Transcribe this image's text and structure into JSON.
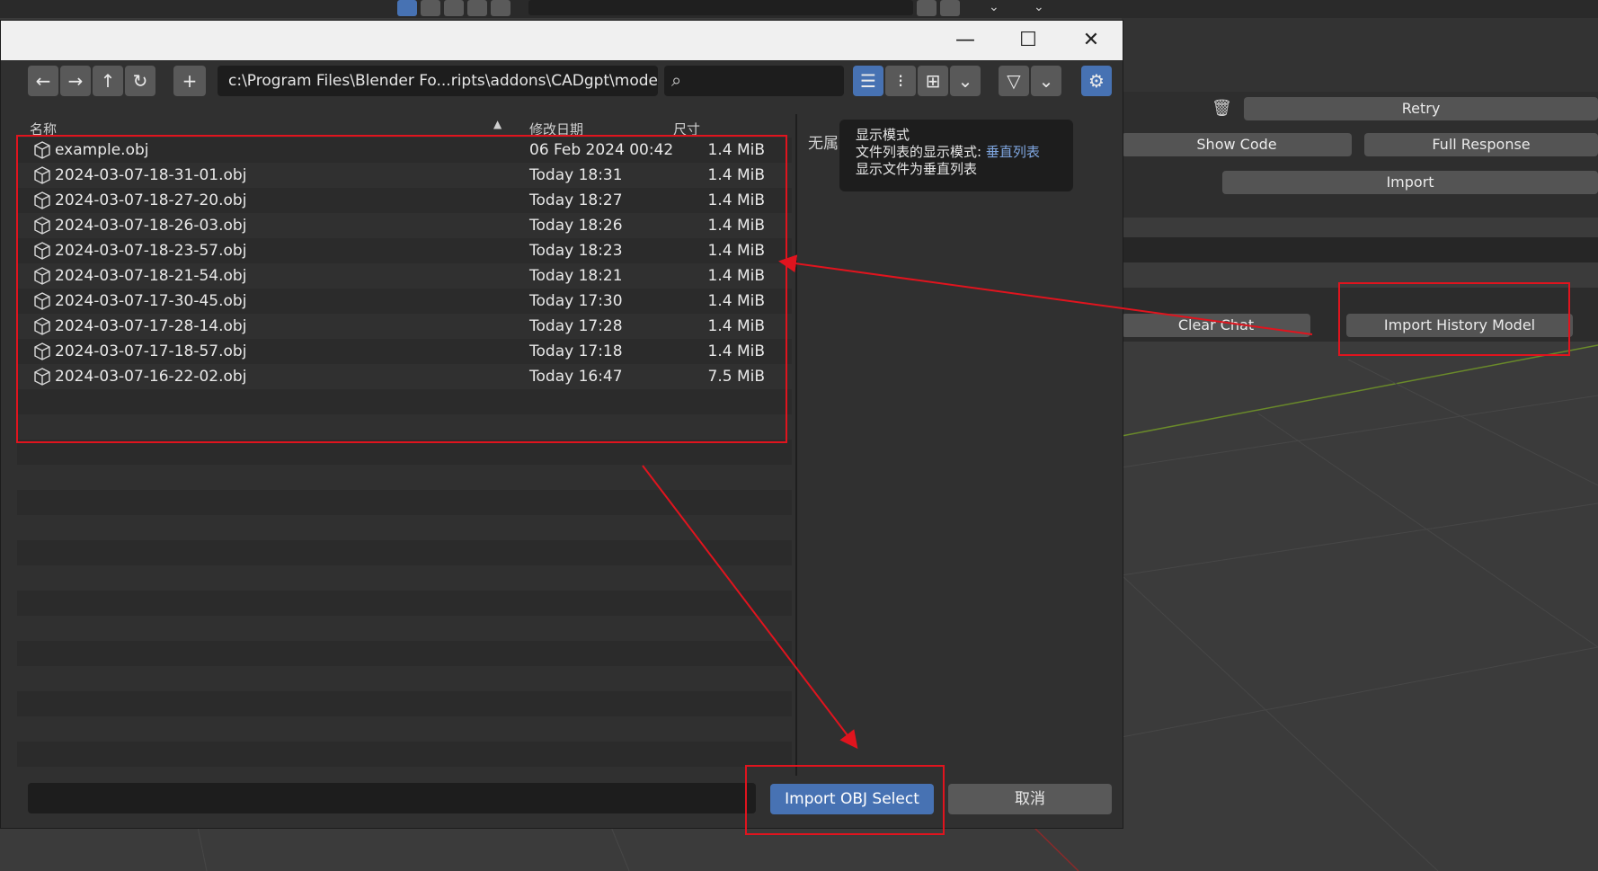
{
  "dialog": {
    "path": "c:\\Program Files\\Blender Fo...ripts\\addons\\CADgpt\\models\\",
    "columns": {
      "name": "名称",
      "date": "修改日期",
      "size": "尺寸"
    },
    "side_label": "无属",
    "tooltip": {
      "title": "显示模式",
      "line2_prefix": "文件列表的显示模式:",
      "line2_value": "垂直列表",
      "line3": "显示文件为垂直列表"
    },
    "files": [
      {
        "name": "example.obj",
        "date": "06 Feb 2024 00:42",
        "size": "1.4 MiB"
      },
      {
        "name": "2024-03-07-18-31-01.obj",
        "date": "Today 18:31",
        "size": "1.4 MiB"
      },
      {
        "name": "2024-03-07-18-27-20.obj",
        "date": "Today 18:27",
        "size": "1.4 MiB"
      },
      {
        "name": "2024-03-07-18-26-03.obj",
        "date": "Today 18:26",
        "size": "1.4 MiB"
      },
      {
        "name": "2024-03-07-18-23-57.obj",
        "date": "Today 18:23",
        "size": "1.4 MiB"
      },
      {
        "name": "2024-03-07-18-21-54.obj",
        "date": "Today 18:21",
        "size": "1.4 MiB"
      },
      {
        "name": "2024-03-07-17-30-45.obj",
        "date": "Today 17:30",
        "size": "1.4 MiB"
      },
      {
        "name": "2024-03-07-17-28-14.obj",
        "date": "Today 17:28",
        "size": "1.4 MiB"
      },
      {
        "name": "2024-03-07-17-18-57.obj",
        "date": "Today 17:18",
        "size": "1.4 MiB"
      },
      {
        "name": "2024-03-07-16-22-02.obj",
        "date": "Today 16:47",
        "size": "7.5 MiB"
      }
    ],
    "import_label": "Import OBJ Select",
    "cancel_label": "取消"
  },
  "panel": {
    "retry": "Retry",
    "show_code": "Show Code",
    "full_response": "Full Response",
    "import": "Import",
    "clear_chat": "Clear Chat",
    "import_history": "Import History Model"
  },
  "colors": {
    "accent": "#4772b3",
    "annotation": "#e0141e",
    "tooltip_link": "#7fa6e0"
  }
}
